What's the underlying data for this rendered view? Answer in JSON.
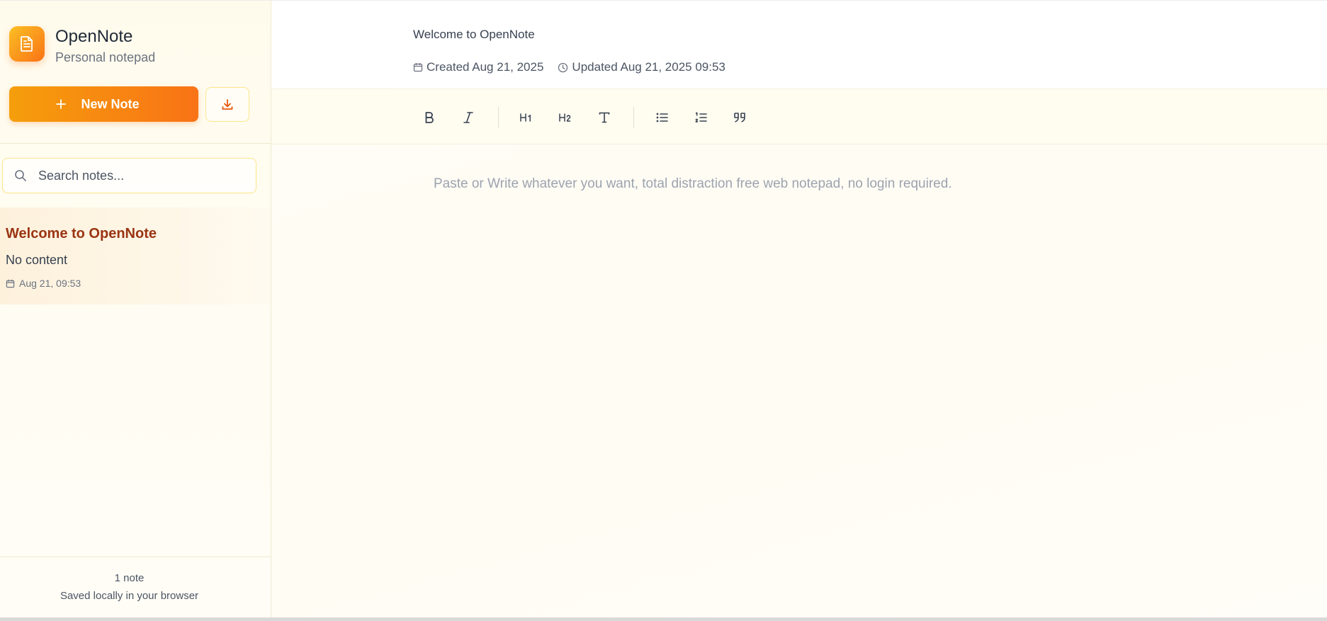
{
  "brand": {
    "title": "OpenNote",
    "subtitle": "Personal notepad",
    "logo_icon": "document-icon",
    "accent_from": "#fbbf24",
    "accent_to": "#f97316"
  },
  "sidebar": {
    "new_note_label": "New Note",
    "download_icon": "download-icon",
    "search": {
      "placeholder": "Search notes...",
      "value": ""
    },
    "notes": [
      {
        "title": "Welcome to OpenNote",
        "preview": "No content",
        "date": "Aug 21, 09:53"
      }
    ],
    "footer": {
      "count": "1 note",
      "saved": "Saved locally in your browser"
    }
  },
  "editor": {
    "title": "Welcome to OpenNote",
    "created": "Created Aug 21, 2025",
    "updated": "Updated Aug 21, 2025 09:53",
    "placeholder": "Paste or Write whatever you want, total distraction free web notepad, no login required.",
    "toolbar": [
      {
        "name": "bold",
        "icon": "bold-icon"
      },
      {
        "name": "italic",
        "icon": "italic-icon"
      },
      {
        "name": "heading-1",
        "icon": "heading-1-icon"
      },
      {
        "name": "heading-2",
        "icon": "heading-2-icon"
      },
      {
        "name": "text",
        "icon": "text-icon"
      },
      {
        "name": "bullet-list",
        "icon": "bullet-list-icon"
      },
      {
        "name": "numbered-list",
        "icon": "numbered-list-icon"
      },
      {
        "name": "quote",
        "icon": "quote-icon"
      }
    ]
  }
}
